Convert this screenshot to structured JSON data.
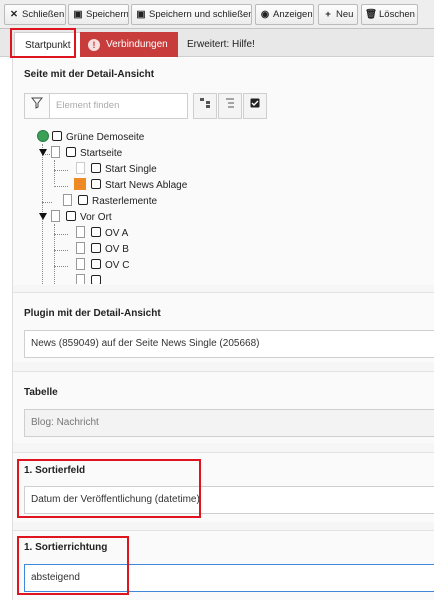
{
  "toolbar": {
    "close": "Schließen",
    "save": "Speichern",
    "save_close": "Speichern und schließen",
    "view": "Anzeigen",
    "new": "Neu",
    "delete": "Löschen"
  },
  "tabs": {
    "start": "Startpunkt",
    "connections": "Verbindungen",
    "extended": "Erweitert: Hilfe!"
  },
  "detail_page": {
    "label": "Seite mit der Detail-Ansicht",
    "filter_placeholder": "Element finden",
    "tree": {
      "root": "Grüne Demoseite",
      "items": [
        "Startseite",
        "Start Single",
        "Start News Ablage",
        "Rasterlemente",
        "Vor Ort",
        "OV A",
        "OV B",
        "OV C"
      ]
    }
  },
  "plugin": {
    "label": "Plugin mit der Detail-Ansicht",
    "value": "News (859049) auf der Seite News Single (205668)"
  },
  "table": {
    "label": "Tabelle",
    "value": "Blog: Nachricht"
  },
  "sort_field": {
    "label": "1. Sortierfeld",
    "value": "Datum der Veröffentlichung (datetime)"
  },
  "sort_direction": {
    "label": "1. Sortierrichtung",
    "value": "absteigend"
  },
  "colors": {
    "error_tab": "#c83c3c",
    "highlight": "#e0141e",
    "focus": "#3d88d8"
  }
}
